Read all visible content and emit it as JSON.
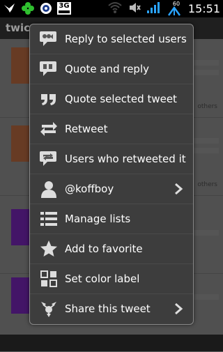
{
  "status_bar": {
    "time": "15:51",
    "badge_3g": "3G",
    "battery_level": "60"
  },
  "app": {
    "title": "twicca"
  },
  "timeline": {
    "tweets": [
      {
        "meta": "others"
      },
      {
        "meta": "others"
      },
      {
        "meta": ""
      },
      {
        "meta": ""
      }
    ]
  },
  "menu": {
    "items": [
      {
        "label": "Reply to selected users",
        "icon": "reply-users-icon"
      },
      {
        "label": "Quote and reply",
        "icon": "quote-reply-icon"
      },
      {
        "label": "Quote selected tweet",
        "icon": "quote-icon"
      },
      {
        "label": "Retweet",
        "icon": "retweet-icon"
      },
      {
        "label": "Users who retweeted it",
        "icon": "retweeted-users-icon"
      },
      {
        "label": "@koffboy",
        "icon": "user-icon"
      },
      {
        "label": "Manage lists",
        "icon": "list-icon"
      },
      {
        "label": "Add to favorite",
        "icon": "star-icon"
      },
      {
        "label": "Set color label",
        "icon": "color-label-icon"
      },
      {
        "label": "Share this tweet",
        "icon": "share-icon"
      }
    ]
  },
  "colors": {
    "menu_background": "#3d3d3d",
    "menu_text": "#ffffff",
    "status_bar": "#000000",
    "wifi_blue": "#2aa3ff"
  }
}
